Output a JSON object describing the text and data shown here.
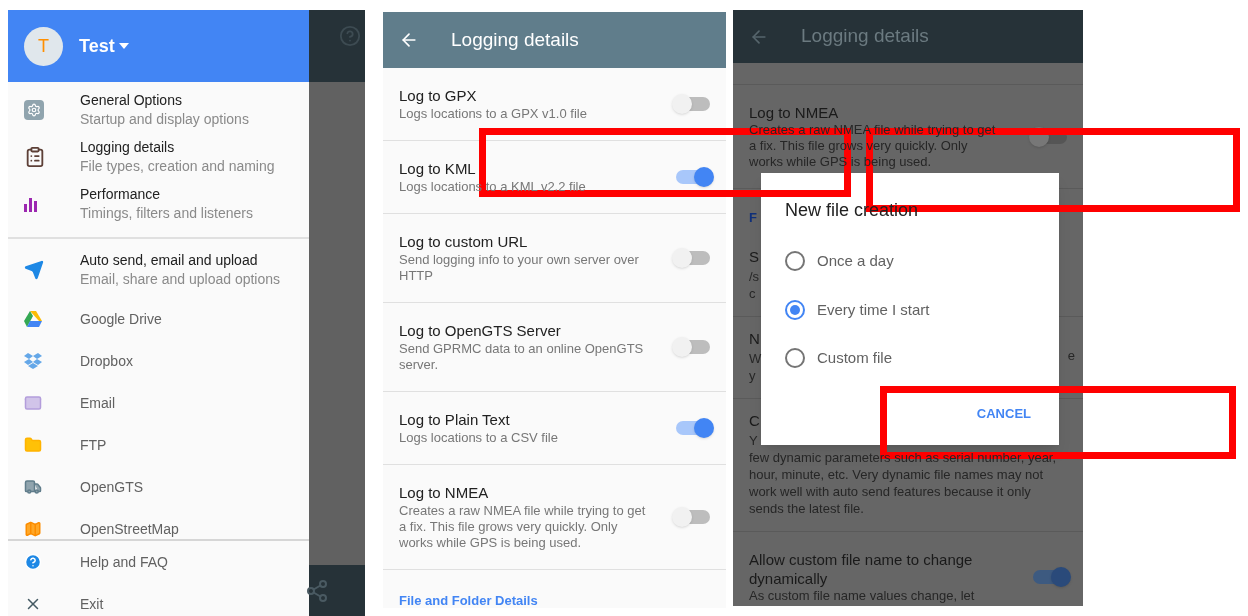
{
  "drawer_screen": {
    "profile": {
      "initial": "T",
      "name": "Test"
    },
    "sections": [
      {
        "items": [
          {
            "title": "General Options",
            "subtitle": "Startup and display options"
          },
          {
            "title": "Logging details",
            "subtitle": "File types, creation and naming"
          },
          {
            "title": "Performance",
            "subtitle": "Timings, filters and listeners"
          }
        ]
      },
      {
        "items": [
          {
            "title": "Auto send, email and upload",
            "subtitle": "Email, share and upload options"
          },
          {
            "title": "Google Drive"
          },
          {
            "title": "Dropbox"
          },
          {
            "title": "Email"
          },
          {
            "title": "FTP"
          },
          {
            "title": "OpenGTS"
          },
          {
            "title": "OpenStreetMap"
          }
        ]
      }
    ],
    "footer_items": [
      {
        "title": "Help and FAQ"
      },
      {
        "title": "Exit"
      }
    ]
  },
  "settings_screen": {
    "title": "Logging details",
    "settings": [
      {
        "title": "Log to GPX",
        "description": "Logs locations to a GPX v1.0 file",
        "on": false
      },
      {
        "title": "Log to KML",
        "description": "Logs locations to a KML v2.2 file",
        "on": true
      },
      {
        "title": "Log to custom URL",
        "description": "Send logging info to your own server over HTTP",
        "on": false
      },
      {
        "title": "Log to OpenGTS Server",
        "description": "Send GPRMC data to an online OpenGTS server.",
        "on": false
      },
      {
        "title": "Log to Plain Text",
        "description": "Logs locations to a CSV file",
        "on": true
      },
      {
        "title": "Log to NMEA",
        "description": "Creates a raw NMEA file while trying to get a fix. This file grows very quickly. Only works while GPS is being used.",
        "on": false
      }
    ],
    "section_link": "File and Folder Details"
  },
  "dialog_screen": {
    "title": "Logging details",
    "background_rows": [
      {
        "kind": "setting",
        "title": "Log to NMEA",
        "description": "Creates a raw NMEA file while trying to get a fix. This file grows very quickly. Only works while GPS is being used.",
        "on": false
      },
      {
        "kind": "section",
        "title": "F"
      },
      {
        "kind": "partial",
        "title": "S",
        "lines": [
          "/s",
          "c"
        ]
      },
      {
        "kind": "partial",
        "title": "N",
        "lines": [
          "W",
          "y"
        ],
        "trailing": "e"
      },
      {
        "kind": "partial",
        "title": "C",
        "lines": [
          "Y",
          "few dynamic parameters such as serial number, year,",
          "hour, minute, etc. Very dynamic file names may not",
          "work well with auto send features because it only",
          "sends the latest file."
        ]
      },
      {
        "kind": "setting",
        "title": "Allow custom file name to change dynamically",
        "description": "As custom file name values change, let",
        "on": true
      }
    ],
    "dialog": {
      "title": "New file creation",
      "options": [
        {
          "label": "Once a day",
          "selected": false
        },
        {
          "label": "Every time I start",
          "selected": true
        },
        {
          "label": "Custom file",
          "selected": false
        }
      ],
      "button": "CANCEL"
    }
  }
}
